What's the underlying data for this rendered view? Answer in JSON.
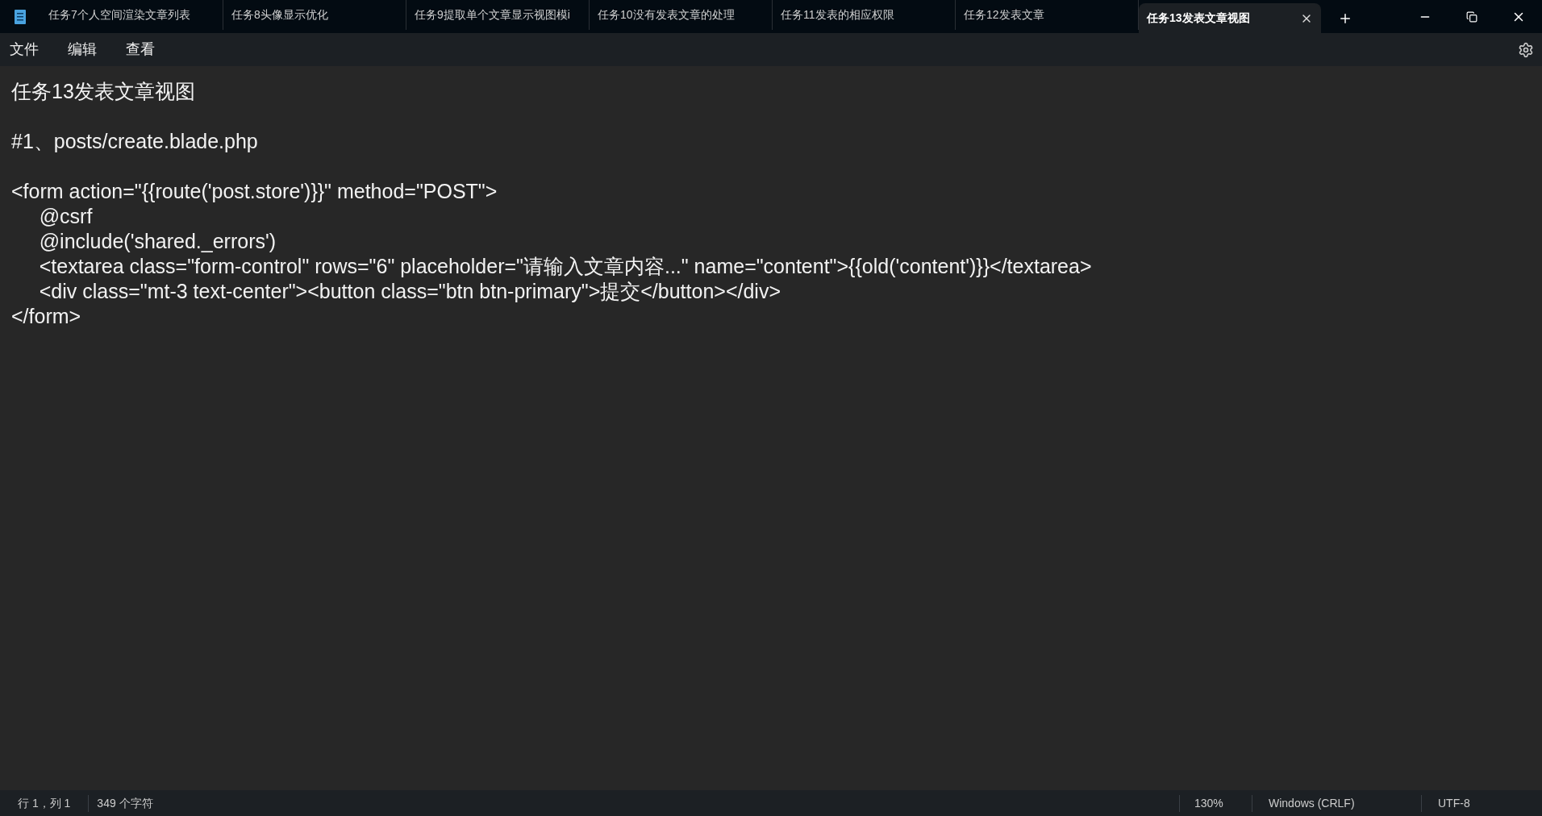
{
  "tabs": [
    {
      "label": "任务7个人空间渲染文章列表",
      "selected": false
    },
    {
      "label": "任务8头像显示优化",
      "selected": false
    },
    {
      "label": "任务9提取单个文章显示视图模i",
      "selected": false
    },
    {
      "label": "任务10没有发表文章的处理",
      "selected": false
    },
    {
      "label": "任务11发表的相应权限",
      "selected": false
    },
    {
      "label": "任务12发表文章",
      "selected": false
    },
    {
      "label": "任务13发表文章视图",
      "selected": true
    }
  ],
  "menu": [
    "文件",
    "编辑",
    "查看"
  ],
  "editor": {
    "paragraphs": [
      [
        "任务13发表文章视图"
      ],
      [
        "#1、posts/create.blade.php"
      ],
      [
        "<form action=\"{{route('post.store')}}\" method=\"POST\">",
        "     @csrf",
        "     @include('shared._errors')",
        "     <textarea class=\"form-control\" rows=\"6\" placeholder=\"请输入文章内容...\" name=\"content\">{{old('content')}}</textarea>",
        "     <div class=\"mt-3 text-center\"><button class=\"btn btn-primary\">提交</button></div>",
        "</form>"
      ]
    ]
  },
  "status_bar": {
    "position": "行 1，列 1",
    "count": "349 个字符",
    "zoom": "130%",
    "line_ending": "Windows (CRLF)",
    "encoding": "UTF-8"
  }
}
